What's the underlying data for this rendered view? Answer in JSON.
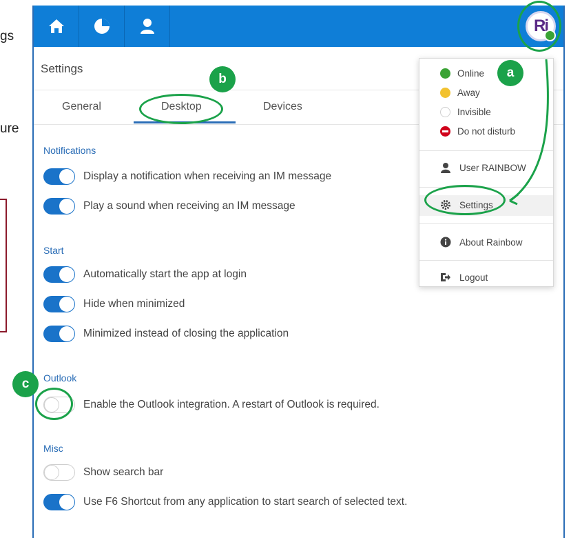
{
  "background_fragments": [
    "gs",
    "ure"
  ],
  "topbar": {
    "nav": [
      {
        "icon": "home-icon"
      },
      {
        "icon": "clock-icon"
      },
      {
        "icon": "user-icon"
      }
    ],
    "avatar": {
      "initials": "Ri",
      "status_color": "#3aa335"
    }
  },
  "settings": {
    "title": "Settings",
    "tabs": [
      "General",
      "Desktop",
      "Devices"
    ],
    "active_tab": "Desktop",
    "sections": [
      {
        "title": "Notifications",
        "items": [
          {
            "label": "Display a notification when receiving an IM message",
            "on": true
          },
          {
            "label": "Play a sound when receiving an IM message",
            "on": true
          }
        ]
      },
      {
        "title": "Start",
        "items": [
          {
            "label": "Automatically start the app at login",
            "on": true
          },
          {
            "label": "Hide when minimized",
            "on": true
          },
          {
            "label": "Minimized instead of closing the application",
            "on": true
          }
        ]
      },
      {
        "title": "Outlook",
        "items": [
          {
            "label": "Enable the Outlook integration. A restart of Outlook is required.",
            "on": false
          }
        ]
      },
      {
        "title": "Misc",
        "items": [
          {
            "label": "Show search bar",
            "on": false
          },
          {
            "label": "Use F6 Shortcut from any application to start search of selected text.",
            "on": true
          }
        ]
      }
    ]
  },
  "menu": {
    "statuses": [
      {
        "label": "Online",
        "color": "#3aa335"
      },
      {
        "label": "Away",
        "color": "#f2c230"
      },
      {
        "label": "Invisible",
        "color": "#ffffff"
      },
      {
        "label": "Do not disturb",
        "color": "#d0021b"
      }
    ],
    "user": "User RAINBOW",
    "settings": "Settings",
    "about": "About Rainbow",
    "logout": "Logout"
  },
  "annotations": {
    "a": "a",
    "b": "b",
    "c": "c"
  },
  "colors": {
    "accent": "#0f7ed7",
    "annotation": "#1ba24a",
    "toggle_on": "#1a73c9"
  }
}
